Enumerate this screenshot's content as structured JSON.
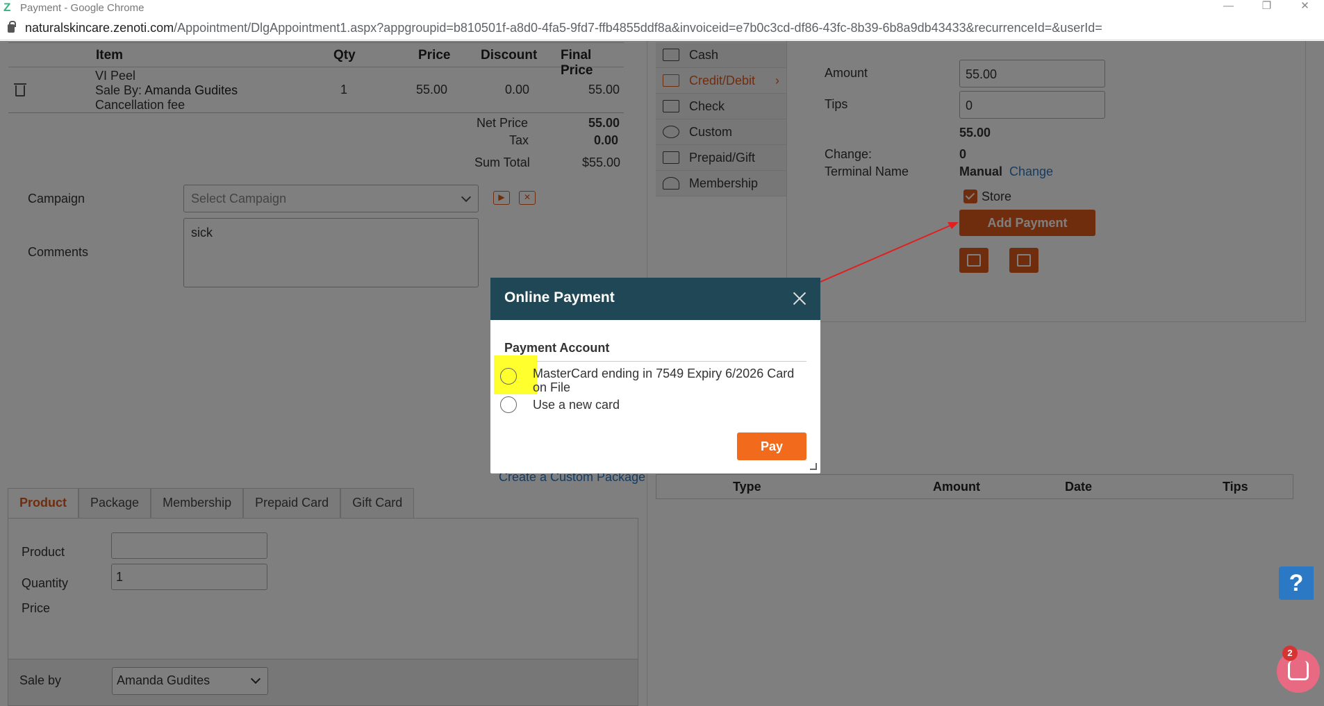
{
  "window": {
    "title": "Payment - Google Chrome",
    "url_host": "naturalskincare.zenoti.com",
    "url_path": "/Appointment/DlgAppointment1.aspx?appgroupid=b810501f-a8d0-4fa5-9fd7-ffb4855ddf8a&invoiceid=e7b0c3cd-df86-43fc-8b39-6b8a9db43433&recurrenceId=&userId="
  },
  "items_table": {
    "headers": {
      "item": "Item",
      "qty": "Qty",
      "price": "Price",
      "discount": "Discount",
      "final_price": "Final Price"
    },
    "rows": [
      {
        "name": "VI Peel",
        "sale_by_label": "Sale By:",
        "sale_by": "Amanda Gudites",
        "note": "Cancellation fee",
        "qty": "1",
        "price": "55.00",
        "discount": "0.00",
        "final_price": "55.00"
      }
    ]
  },
  "totals": {
    "net_price_label": "Net Price",
    "net_price": "55.00",
    "tax_label": "Tax",
    "tax": "0.00",
    "sum_total_label": "Sum Total",
    "sum_total": "$55.00"
  },
  "campaign": {
    "label": "Campaign",
    "placeholder": "Select Campaign"
  },
  "comments": {
    "label": "Comments",
    "value": "sick"
  },
  "create_custom_package": "Create a Custom Package",
  "tabs": [
    {
      "label": "Product",
      "active": true
    },
    {
      "label": "Package"
    },
    {
      "label": "Membership"
    },
    {
      "label": "Prepaid Card"
    },
    {
      "label": "Gift Card"
    }
  ],
  "product_form": {
    "product_label": "Product",
    "product_value": "",
    "quantity_label": "Quantity",
    "quantity_value": "1",
    "price_label": "Price",
    "sale_by_label": "Sale by",
    "sale_by_value": "Amanda Gudites"
  },
  "payment_methods": [
    {
      "label": "Cash",
      "icon": "cash-icon"
    },
    {
      "label": "Credit/Debit",
      "icon": "card-icon",
      "active": true
    },
    {
      "label": "Check",
      "icon": "check-icon"
    },
    {
      "label": "Custom",
      "icon": "coins-icon"
    },
    {
      "label": "Prepaid/Gift",
      "icon": "gift-card-icon"
    },
    {
      "label": "Membership",
      "icon": "membership-icon"
    }
  ],
  "payment_details": {
    "amount_label": "Amount",
    "amount_value": "55.00",
    "tips_label": "Tips",
    "tips_value": "0",
    "total": "55.00",
    "change_label": "Change:",
    "change_value": "0",
    "terminal_label": "Terminal Name",
    "terminal_value": "Manual",
    "terminal_change": "Change",
    "store_label": "Store",
    "add_payment": "Add Payment"
  },
  "history_table": {
    "type": "Type",
    "amount": "Amount",
    "date": "Date",
    "tips": "Tips"
  },
  "help_label": "?",
  "chat_badge": "2",
  "modal": {
    "title": "Online Payment",
    "account_label": "Payment Account",
    "options": [
      {
        "text": "MasterCard ending in 7549 Expiry 6/2026   Card on File"
      },
      {
        "text": "Use a new card"
      }
    ],
    "pay_label": "Pay"
  },
  "colors": {
    "accent": "#e05a1c",
    "modal_header": "#1f4756",
    "link": "#2b78c5",
    "highlight": "#ffff2e"
  }
}
